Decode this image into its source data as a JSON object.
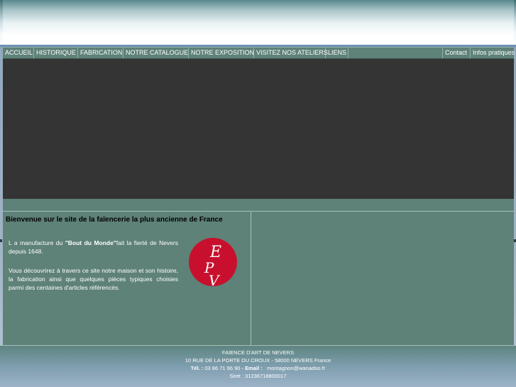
{
  "nav": {
    "items": [
      "ACCUEIL",
      "HISTORIQUE",
      "FABRICATION",
      "NOTRE CATALOGUE",
      "NOTRE EXPOSITION",
      "VISITEZ NOS ATELIERS",
      "LIENS"
    ],
    "right_items": [
      "Contact",
      "Infos pratiques"
    ]
  },
  "welcome": {
    "title": "Bienvenue sur le site de la faïencerie la plus ancienne de France",
    "p1_pre": "L a manufacture   du ",
    "p1_bold": "\"Bout du Monde\"",
    "p1_post": "fait la fierté de Nevers depuis 1648.",
    "p2": "Vous découvrirez à travers ce site notre maison et son histoire, la fabrication ainsi que quelques pièces typiques choisies parmi des centaines d'articles référencés."
  },
  "logo": {
    "letters": [
      "E",
      "P",
      "V"
    ]
  },
  "footer": {
    "company": "FAIENCE D'ART DE NEVERS",
    "address": "10 RUE DE LA PORTE DU CROUX - 58000 NEVERS France",
    "tel_label": "Tél. :",
    "tel": "03 86 71 96 90",
    "email_label": "- Email :",
    "email": "montagnon@wanadoo.fr",
    "siret": "Siret : 31236718800017"
  },
  "colors": {
    "nav_bg": "#5e8178",
    "banner_bg": "#343434",
    "logo_red": "#c8102e"
  }
}
